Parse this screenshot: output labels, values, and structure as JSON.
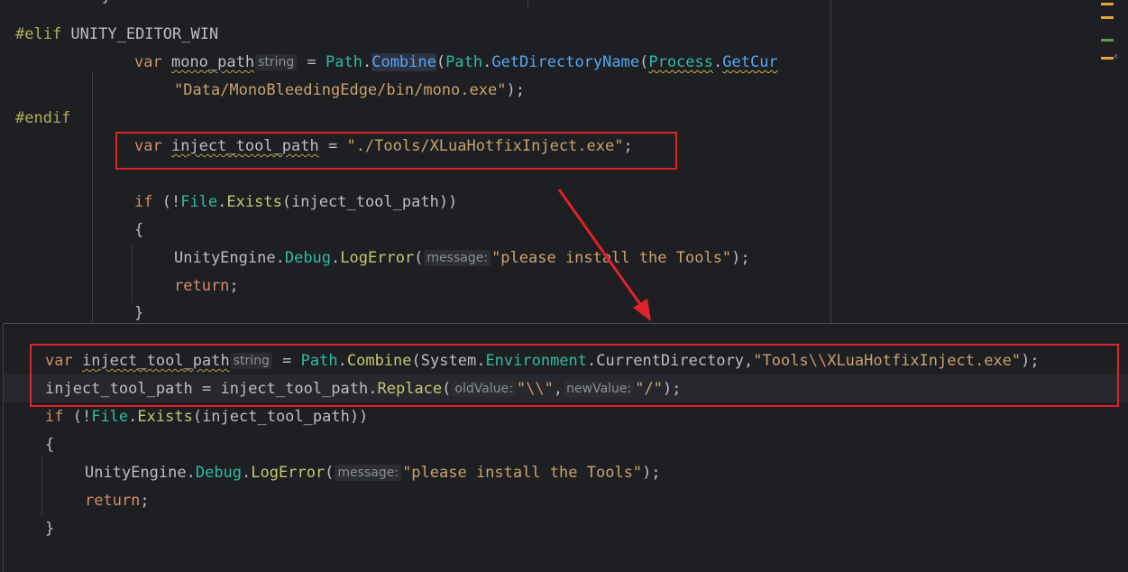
{
  "top_code": {
    "line1": {
      "pre": "#elif",
      "rest": " UNITY_EDITOR_WIN"
    },
    "line2": {
      "var": "var",
      "name": "mono_path",
      "hint": "string",
      "eq": " = ",
      "path": "Path",
      "dot": ".",
      "combine": "Combine",
      "open": "(",
      "path2": "Path",
      "dot2": ".",
      "getdir": "GetDirectoryName",
      "open2": "(",
      "process": "Process",
      "dot3": ".",
      "getcur": "GetCur"
    },
    "line3": {
      "str": "\"Data/MonoBleedingEdge/bin/mono.exe\"",
      "close": ");"
    },
    "line4": {
      "pre": "#endif"
    },
    "line5": {
      "var": "var",
      "name": "inject_tool_path",
      "eq": " = ",
      "str": "\"./Tools/XLuaHotfixInject.exe\"",
      "semi": ";"
    },
    "line6": {
      "if": "if",
      "open": " (!",
      "file": "File",
      "dot": ".",
      "exists": "Exists",
      "args": "(inject_tool_path))"
    },
    "line7": {
      "brace": "{"
    },
    "line8": {
      "unity": "UnityEngine",
      "dot": ".",
      "debug": "Debug",
      "dot2": ".",
      "logerror": "LogError",
      "open": "(",
      "hint": "message:",
      "str": "\"please install the Tools\"",
      "close": ");"
    },
    "line9": {
      "ret": "return",
      "semi": ";"
    },
    "line10": {
      "brace": "}"
    }
  },
  "bottom_code": {
    "line1": {
      "var": "var",
      "name": "inject_tool_path",
      "hint": "string",
      "eq": " = ",
      "path": "Path",
      "dot": ".",
      "combine": "Combine",
      "open": "(",
      "system": "System",
      "dot2": ".",
      "env": "Environment",
      "dot3": ".",
      "curdir": "CurrentDirectory",
      "comma": ",",
      "str1": "\"Tools",
      "esc": "\\\\",
      "str2": "XLuaHotfixInject.exe\"",
      "close": ");"
    },
    "line2": {
      "name": "inject_tool_path",
      "eq": " = ",
      "name2": "inject_tool_path",
      "dot": ".",
      "replace": "Replace",
      "open": "(",
      "hint1": "oldValue:",
      "str1a": "\"",
      "esc1": "\\\\",
      "str1b": "\"",
      "comma": ",",
      "hint2": "newValue:",
      "str2": "\"/\"",
      "close": ");"
    },
    "line3": {
      "if": "if",
      "open": " (!",
      "file": "File",
      "dot": ".",
      "exists": "Exists",
      "args": "(inject_tool_path))"
    },
    "line4": {
      "brace": "{"
    },
    "line5": {
      "unity": "UnityEngine",
      "dot": ".",
      "debug": "Debug",
      "dot2": ".",
      "logerror": "LogError",
      "open": "(",
      "hint": "message:",
      "str": "\"please install the Tools\"",
      "close": ");"
    },
    "line6": {
      "ret": "return",
      "semi": ";"
    },
    "line7": {
      "brace": "}"
    }
  },
  "colors": {
    "annotation_red": "#e0222c",
    "background": "#1e1f22"
  }
}
